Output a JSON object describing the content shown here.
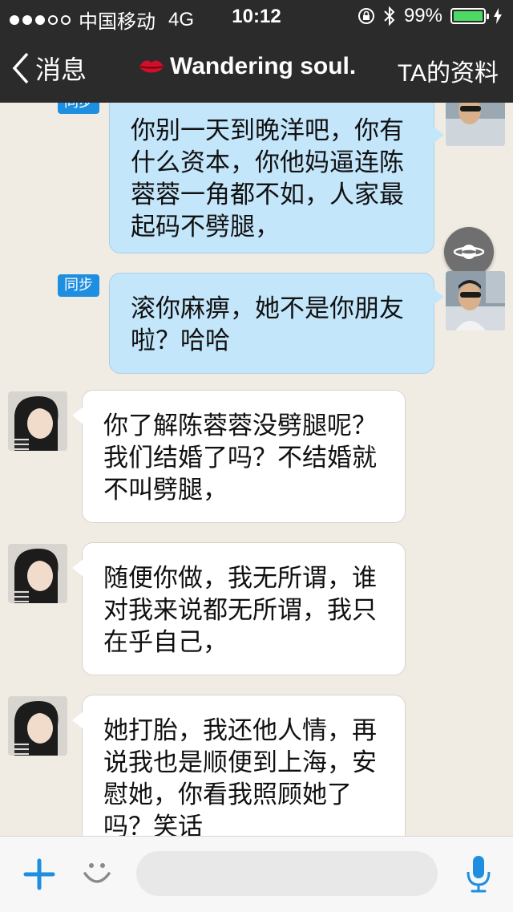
{
  "status": {
    "carrier": "中国移动",
    "network": "4G",
    "time": "10:12",
    "battery": "99%",
    "battery_level": 0.99
  },
  "nav": {
    "back_label": "消息",
    "title": "Wandering soul.",
    "profile_label": "TA的资料"
  },
  "messages": [
    {
      "side": "out",
      "badge": "同步",
      "text": "你别一天到晚洋吧，你有什么资本，你他妈逼连陈蓉蓉一角都不如，人家最起码不劈腿，"
    },
    {
      "side": "out",
      "badge": "同步",
      "text": "滚你麻痹，她不是你朋友啦？哈哈"
    },
    {
      "side": "in",
      "text": "你了解陈蓉蓉没劈腿呢？我们结婚了吗？不结婚就不叫劈腿，"
    },
    {
      "side": "in",
      "text": "随便你做，我无所谓，谁对我来说都无所谓，我只在乎自己，"
    },
    {
      "side": "in",
      "text": "她打胎，我还他人情，再说我也是顺便到上海，安慰她，你看我照顾她了吗？笑话"
    }
  ],
  "input": {
    "placeholder": "",
    "value": ""
  },
  "colors": {
    "bar": "#2b2b2b",
    "out_bubble": "#c4e6fb",
    "in_bubble": "#ffffff",
    "accent": "#1e8fe0",
    "battery": "#4cd964"
  },
  "icons": [
    "back-chevron-icon",
    "lips-icon",
    "planet-icon",
    "plus-icon",
    "smiley-icon",
    "microphone-icon",
    "bluetooth-icon",
    "rotation-lock-icon"
  ]
}
